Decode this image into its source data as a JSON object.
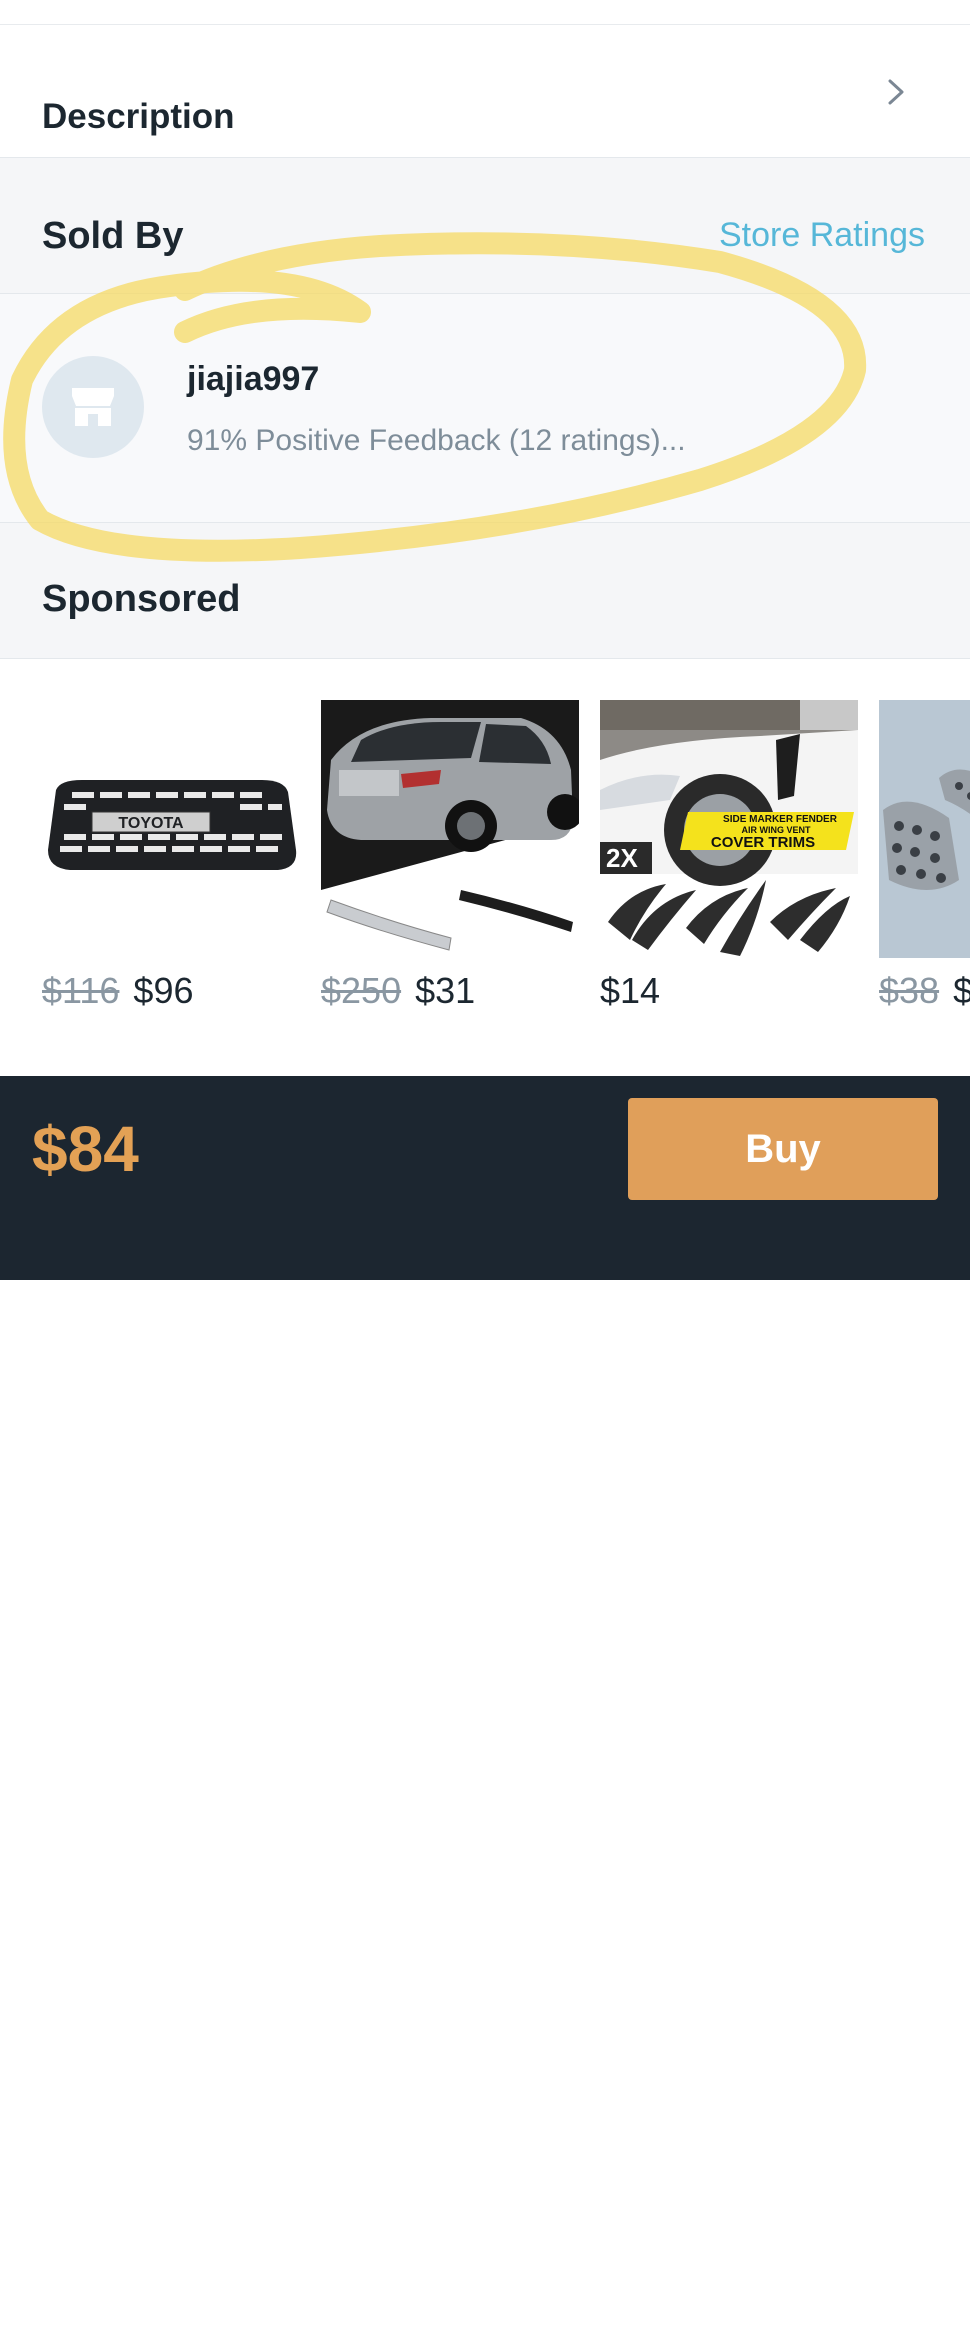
{
  "description": {
    "label": "Description",
    "chevron_icon": "chevron-right-icon"
  },
  "sold_by": {
    "title": "Sold By",
    "store_ratings_link": "Store Ratings"
  },
  "seller": {
    "avatar_icon": "store-icon",
    "name": "jiajia997",
    "feedback": "91% Positive Feedback (12 ratings)..."
  },
  "sponsored": {
    "title": "Sponsored",
    "products": [
      {
        "image": "toyota-grille",
        "image_text": "TOYOTA",
        "old_price": "$116",
        "price": "$96"
      },
      {
        "image": "silver-suv-trim",
        "old_price": "$250",
        "price": "$31"
      },
      {
        "image": "side-marker-fender-vents",
        "overlay_count": "2X",
        "banner_lines": [
          "SIDE MARKER FENDER",
          "AIR WING VENT",
          "COVER TRIMS"
        ],
        "old_price": "",
        "price": "$14"
      },
      {
        "image": "pedal-covers",
        "old_price": "$38",
        "price": "$"
      }
    ]
  },
  "footer": {
    "total_price": "$84",
    "buy_label": "Buy"
  },
  "colors": {
    "accent": "#e09f5a",
    "link": "#56b7d8",
    "dark_bar": "#1c2630",
    "highlight": "#f6d964"
  }
}
